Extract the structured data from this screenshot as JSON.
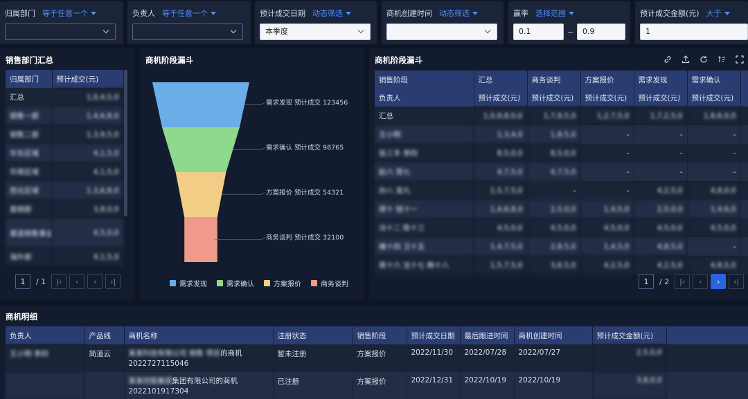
{
  "filters": [
    {
      "label": "归属部门",
      "mode": "等于任意一个",
      "value": "",
      "style": "dark"
    },
    {
      "label": "负责人",
      "mode": "等于任意一个",
      "value": "",
      "style": "dark"
    },
    {
      "label": "预计成交日期",
      "mode": "动态筛选",
      "value": "本季度",
      "style": "light"
    },
    {
      "label": "商机创建时间",
      "mode": "动态筛选",
      "value": "",
      "style": "light"
    },
    {
      "label": "赢率",
      "mode": "选择范围",
      "min": "0.1",
      "max": "0.9",
      "sep": "~"
    },
    {
      "label": "预计成交金额(元)",
      "mode": "大于",
      "value": "1"
    }
  ],
  "dept_summary": {
    "title": "销售部门汇总",
    "headers": [
      "归属部门",
      "预计成交(元)"
    ],
    "rows": [
      {
        "dept": "汇总",
        "amount": "1,0,4,5,0"
      },
      {
        "dept": "销售一部",
        "amount": "1,4,6,8,0"
      },
      {
        "dept": "销售二部",
        "amount": "1,3,9,5,0"
      },
      {
        "dept": "华东区域",
        "amount": "4,1,5,0"
      },
      {
        "dept": "华南区域",
        "amount": "4,1,5,0"
      },
      {
        "dept": "西北区域",
        "amount": "1,3,6,8,0"
      },
      {
        "dept": "直销部",
        "amount": "3,8,0,0"
      },
      {
        "dept": "渠道销售事业部",
        "amount": "4,5,0,0"
      },
      {
        "dept": "海外部",
        "amount": "4,1,5,0"
      }
    ],
    "pager": {
      "current": "1",
      "total": "/ 1"
    }
  },
  "funnel": {
    "title": "商机阶段漏斗",
    "stages": [
      {
        "name": "需求发现",
        "label": "需求发现 预计成交 123456",
        "color": "#6aaee8",
        "value": 100
      },
      {
        "name": "需求确认",
        "label": "需求确认 预计成交 98765",
        "color": "#8ed98e",
        "value": 80
      },
      {
        "name": "方案报价",
        "label": "方案报价 预计成交 54321",
        "color": "#f2cd86",
        "value": 52
      },
      {
        "name": "商务谈判",
        "label": "商务谈判 预计成交 32100",
        "color": "#ef9a8a",
        "value": 34
      }
    ]
  },
  "stage_funnel": {
    "title": "商机阶段漏斗",
    "header_top": [
      "销售阶段",
      "汇总",
      "商务谈判",
      "方案报价",
      "需求发现",
      "需求确认"
    ],
    "header_bottom": [
      "负责人",
      "预计成交(元)",
      "预计成交(元)",
      "预计成交(元)",
      "预计成交(元)",
      "预计成交(元)"
    ],
    "rows": [
      [
        "汇总",
        "1,0,9,8,0,0",
        "1,7,9,5,0",
        "1,2,7,5,0",
        "1,7,2,5,0",
        "1,8,6,0,0"
      ],
      [
        "王小明",
        "1,3,4,0",
        "1,8,5,0",
        "-",
        "-",
        "-"
      ],
      [
        "张三丰 李四",
        "8,5,0,0",
        "8,5,0,0",
        "-",
        "-",
        "-"
      ],
      [
        "赵六 周七",
        "4,7,5,0",
        "4,7,5,0",
        "-",
        "-",
        "-"
      ],
      [
        "孙八 吴九",
        "1,5,7,5,0",
        "-",
        "-",
        "4,2,5,0",
        "4,8,0,0"
      ],
      [
        "郑十 钱十一",
        "1,4,6,8,0",
        "2,5,0,0",
        "1,4,5,0",
        "2,5,0,0",
        "1,4,6,0"
      ],
      [
        "冯十二 陈十三",
        "4,5,0,0",
        "4,5,0,0",
        "4,5,0,0",
        "4,5,0,0",
        "4,5,0,0"
      ],
      [
        "褚十四 卫十五",
        "1,4,7,5,0",
        "2,8,5,0",
        "1,4,5,0",
        "4,8,5,0",
        "-"
      ],
      [
        "蒋十六 沈十七 韩十八",
        "1,5,7,5,0",
        "3,6,5,0",
        "4,2,5,0",
        "4,2,5,0",
        "4,8,5,0"
      ]
    ],
    "pager": {
      "current": "1",
      "total": "/ 2"
    }
  },
  "details": {
    "title": "商机明细",
    "headers": [
      "负责人",
      "产品线",
      "商机名称",
      "注册状态",
      "销售阶段",
      "预计成交日期",
      "最后跟进时间",
      "商机创建时间",
      "预计成交金额(元)"
    ],
    "rows": [
      {
        "owner": "王小明 李四",
        "product": "简道云",
        "name_blur": "某某科技有限公司 销售 项目",
        "name_suffix": "的商机",
        "name_id": "2022727115046",
        "status": "暂未注册",
        "stage": "方案报价",
        "close_date": "2022/11/30",
        "last_follow": "2022/07/28",
        "created": "2022/07/27",
        "amount": "2,5,0,0"
      },
      {
        "owner": "",
        "product": "",
        "name_blur": "某某控股集团",
        "name_suffix": "集团有限公司的商机",
        "name_id": "2022101917304",
        "status": "已注册",
        "stage": "方案报价",
        "close_date": "2022/12/31",
        "last_follow": "2022/10/19",
        "created": "2022/10/19",
        "amount": "3,8,0,0"
      }
    ]
  },
  "icons": [
    "link-icon",
    "export-icon",
    "refresh-icon",
    "sort-icon",
    "fullscreen-icon"
  ]
}
